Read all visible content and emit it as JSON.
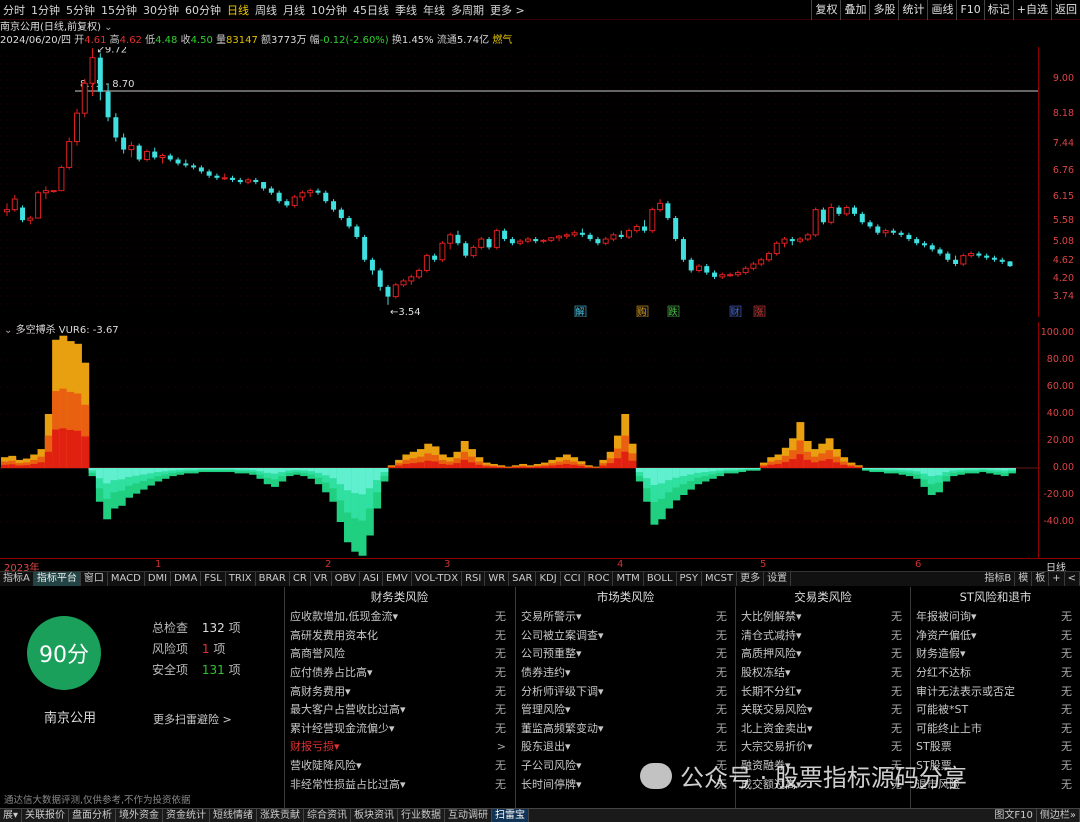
{
  "colors": {
    "up": "#e02020",
    "down": "#40e0e0",
    "accent": "#f0c800",
    "grid": "#8b0000",
    "score_green": "#1aa05a"
  },
  "topbar": {
    "periods": [
      "分时",
      "1分钟",
      "5分钟",
      "15分钟",
      "30分钟",
      "60分钟",
      "日线",
      "周线",
      "月线",
      "10分钟",
      "45日线",
      "季线",
      "年线",
      "多周期",
      "更多 >"
    ],
    "active_period": "日线",
    "right_tools": [
      "复权",
      "叠加",
      "多股",
      "统计",
      "画线",
      "F10",
      "标记",
      "+自选",
      "返回"
    ]
  },
  "info": {
    "name_line": "南京公用(日线,前复权)",
    "date": "2024/06/20/四",
    "open_label": "开",
    "open": "4.61",
    "high_label": "高",
    "high": "4.62",
    "low_label": "低",
    "low": "4.48",
    "close_label": "收",
    "close": "4.50",
    "vol_label": "量",
    "vol": "83147",
    "amt_label": "额",
    "amt": "3773万",
    "chg_label": "幅",
    "chg": "-0.12(-2.60%)",
    "turn_label": "换",
    "turn": "1.45%",
    "float_label": "流通",
    "float": "5.74亿",
    "sector": "燃气"
  },
  "kline": {
    "yaxis_labels": [
      "9.00",
      "8.18",
      "7.44",
      "6.76",
      "6.15",
      "5.58",
      "5.08",
      "4.62",
      "4.20",
      "3.74"
    ],
    "max_label": "9.72",
    "min_label": "3.54",
    "line_label": "8.75 - 8.70",
    "event_markers": [
      "解",
      "购",
      "跌",
      "财",
      "涨"
    ],
    "candles_ohlc": [
      [
        5.8,
        6.0,
        5.7,
        5.85
      ],
      [
        5.85,
        6.2,
        5.8,
        6.1
      ],
      [
        5.9,
        5.95,
        5.55,
        5.6
      ],
      [
        5.6,
        5.7,
        5.5,
        5.65
      ],
      [
        5.65,
        6.3,
        5.65,
        6.25
      ],
      [
        6.25,
        6.4,
        6.1,
        6.3
      ],
      [
        6.3,
        6.3,
        6.25,
        6.3
      ],
      [
        6.3,
        6.9,
        6.3,
        6.85
      ],
      [
        6.85,
        7.6,
        6.8,
        7.5
      ],
      [
        7.5,
        8.3,
        7.4,
        8.2
      ],
      [
        8.2,
        9.0,
        8.1,
        8.9
      ],
      [
        8.9,
        9.72,
        8.6,
        9.5
      ],
      [
        9.5,
        9.6,
        8.5,
        8.7
      ],
      [
        8.7,
        8.9,
        8.0,
        8.1
      ],
      [
        8.1,
        8.2,
        7.5,
        7.6
      ],
      [
        7.6,
        7.7,
        7.2,
        7.3
      ],
      [
        7.3,
        7.5,
        7.1,
        7.4
      ],
      [
        7.4,
        7.45,
        7.0,
        7.05
      ],
      [
        7.05,
        7.3,
        7.0,
        7.25
      ],
      [
        7.25,
        7.35,
        7.05,
        7.1
      ],
      [
        7.1,
        7.2,
        6.95,
        7.15
      ],
      [
        7.15,
        7.2,
        7.0,
        7.05
      ],
      [
        7.05,
        7.1,
        6.9,
        6.95
      ],
      [
        6.95,
        7.05,
        6.85,
        6.9
      ],
      [
        6.9,
        6.95,
        6.8,
        6.85
      ],
      [
        6.85,
        6.9,
        6.7,
        6.75
      ],
      [
        6.75,
        6.8,
        6.6,
        6.65
      ],
      [
        6.65,
        6.7,
        6.55,
        6.6
      ],
      [
        6.6,
        6.7,
        6.55,
        6.6
      ],
      [
        6.6,
        6.65,
        6.5,
        6.55
      ],
      [
        6.55,
        6.6,
        6.45,
        6.5
      ],
      [
        6.5,
        6.6,
        6.45,
        6.55
      ],
      [
        6.55,
        6.6,
        6.45,
        6.5
      ],
      [
        6.5,
        6.5,
        6.3,
        6.35
      ],
      [
        6.35,
        6.4,
        6.2,
        6.25
      ],
      [
        6.25,
        6.3,
        6.0,
        6.05
      ],
      [
        6.05,
        6.1,
        5.9,
        5.95
      ],
      [
        5.95,
        6.2,
        5.9,
        6.15
      ],
      [
        6.15,
        6.3,
        6.05,
        6.25
      ],
      [
        6.25,
        6.35,
        6.15,
        6.3
      ],
      [
        6.3,
        6.35,
        6.2,
        6.25
      ],
      [
        6.25,
        6.3,
        6.0,
        6.05
      ],
      [
        6.05,
        6.1,
        5.8,
        5.85
      ],
      [
        5.85,
        5.9,
        5.6,
        5.65
      ],
      [
        5.65,
        5.7,
        5.4,
        5.45
      ],
      [
        5.45,
        5.5,
        5.15,
        5.2
      ],
      [
        5.2,
        5.25,
        4.6,
        4.65
      ],
      [
        4.65,
        4.7,
        4.3,
        4.4
      ],
      [
        4.4,
        4.45,
        3.9,
        4.0
      ],
      [
        4.0,
        4.05,
        3.54,
        3.75
      ],
      [
        3.75,
        4.1,
        3.7,
        4.05
      ],
      [
        4.05,
        4.2,
        4.0,
        4.15
      ],
      [
        4.15,
        4.3,
        4.05,
        4.25
      ],
      [
        4.25,
        4.45,
        4.2,
        4.4
      ],
      [
        4.4,
        4.8,
        4.35,
        4.75
      ],
      [
        4.75,
        4.8,
        4.6,
        4.65
      ],
      [
        4.65,
        5.1,
        4.6,
        5.05
      ],
      [
        5.05,
        5.3,
        4.9,
        5.25
      ],
      [
        5.25,
        5.35,
        5.0,
        5.05
      ],
      [
        5.05,
        5.1,
        4.7,
        4.75
      ],
      [
        4.75,
        5.0,
        4.7,
        4.95
      ],
      [
        4.95,
        5.2,
        4.9,
        5.15
      ],
      [
        5.15,
        5.2,
        4.9,
        4.95
      ],
      [
        4.95,
        5.4,
        4.9,
        5.35
      ],
      [
        5.35,
        5.4,
        5.1,
        5.15
      ],
      [
        5.15,
        5.2,
        5.0,
        5.05
      ],
      [
        5.05,
        5.15,
        5.0,
        5.1
      ],
      [
        5.1,
        5.2,
        5.05,
        5.15
      ],
      [
        5.15,
        5.2,
        5.05,
        5.1
      ],
      [
        5.1,
        5.15,
        5.05,
        5.12
      ],
      [
        5.12,
        5.2,
        5.08,
        5.18
      ],
      [
        5.18,
        5.25,
        5.1,
        5.22
      ],
      [
        5.22,
        5.3,
        5.15,
        5.25
      ],
      [
        5.25,
        5.35,
        5.2,
        5.3
      ],
      [
        5.3,
        5.4,
        5.2,
        5.25
      ],
      [
        5.25,
        5.3,
        5.1,
        5.15
      ],
      [
        5.15,
        5.2,
        5.0,
        5.05
      ],
      [
        5.05,
        5.2,
        5.0,
        5.15
      ],
      [
        5.15,
        5.3,
        5.1,
        5.25
      ],
      [
        5.25,
        5.35,
        5.15,
        5.2
      ],
      [
        5.2,
        5.4,
        5.15,
        5.35
      ],
      [
        5.35,
        5.5,
        5.3,
        5.45
      ],
      [
        5.45,
        5.6,
        5.3,
        5.35
      ],
      [
        5.35,
        5.9,
        5.3,
        5.85
      ],
      [
        5.85,
        6.1,
        5.8,
        6.0
      ],
      [
        6.0,
        6.05,
        5.6,
        5.65
      ],
      [
        5.65,
        5.7,
        5.1,
        5.15
      ],
      [
        5.15,
        5.2,
        4.6,
        4.65
      ],
      [
        4.65,
        4.7,
        4.35,
        4.4
      ],
      [
        4.4,
        4.55,
        4.35,
        4.5
      ],
      [
        4.5,
        4.55,
        4.3,
        4.35
      ],
      [
        4.35,
        4.4,
        4.2,
        4.25
      ],
      [
        4.25,
        4.35,
        4.2,
        4.3
      ],
      [
        4.3,
        4.35,
        4.25,
        4.3
      ],
      [
        4.3,
        4.4,
        4.25,
        4.35
      ],
      [
        4.35,
        4.5,
        4.3,
        4.45
      ],
      [
        4.45,
        4.6,
        4.4,
        4.55
      ],
      [
        4.55,
        4.7,
        4.5,
        4.65
      ],
      [
        4.65,
        4.85,
        4.6,
        4.8
      ],
      [
        4.8,
        5.1,
        4.75,
        5.05
      ],
      [
        5.05,
        5.2,
        4.95,
        5.15
      ],
      [
        5.15,
        5.2,
        5.0,
        5.1
      ],
      [
        5.1,
        5.2,
        5.05,
        5.15
      ],
      [
        5.15,
        5.3,
        5.1,
        5.25
      ],
      [
        5.25,
        5.9,
        5.2,
        5.85
      ],
      [
        5.85,
        5.9,
        5.5,
        5.55
      ],
      [
        5.55,
        6.0,
        5.5,
        5.9
      ],
      [
        5.9,
        5.95,
        5.7,
        5.75
      ],
      [
        5.75,
        5.95,
        5.7,
        5.9
      ],
      [
        5.9,
        5.95,
        5.7,
        5.75
      ],
      [
        5.75,
        5.8,
        5.5,
        5.55
      ],
      [
        5.55,
        5.6,
        5.4,
        5.45
      ],
      [
        5.45,
        5.5,
        5.25,
        5.3
      ],
      [
        5.3,
        5.4,
        5.2,
        5.35
      ],
      [
        5.35,
        5.4,
        5.25,
        5.3
      ],
      [
        5.3,
        5.35,
        5.2,
        5.25
      ],
      [
        5.25,
        5.3,
        5.1,
        5.15
      ],
      [
        5.15,
        5.2,
        5.0,
        5.05
      ],
      [
        5.05,
        5.1,
        4.95,
        5.0
      ],
      [
        5.0,
        5.05,
        4.85,
        4.9
      ],
      [
        4.9,
        4.95,
        4.75,
        4.8
      ],
      [
        4.8,
        4.85,
        4.6,
        4.65
      ],
      [
        4.65,
        4.75,
        4.5,
        4.55
      ],
      [
        4.55,
        4.8,
        4.5,
        4.75
      ],
      [
        4.75,
        4.85,
        4.7,
        4.8
      ],
      [
        4.8,
        4.85,
        4.7,
        4.75
      ],
      [
        4.75,
        4.8,
        4.65,
        4.7
      ],
      [
        4.7,
        4.75,
        4.6,
        4.65
      ],
      [
        4.65,
        4.7,
        4.55,
        4.6
      ],
      [
        4.61,
        4.62,
        4.48,
        4.5
      ]
    ]
  },
  "vur": {
    "title": "多空搏杀",
    "label": "VUR6:",
    "value": "-3.67",
    "yaxis_labels": [
      "100.00",
      "80.00",
      "60.00",
      "40.00",
      "20.00",
      "0.00",
      "-20.00",
      "-40.00"
    ],
    "values": [
      8,
      9,
      6,
      7,
      10,
      14,
      40,
      95,
      98,
      94,
      92,
      78,
      -6,
      -25,
      -38,
      -30,
      -28,
      -22,
      -19,
      -16,
      -13,
      -10,
      -8,
      -6,
      -5,
      -4,
      -4,
      -3,
      -3,
      -3,
      -3,
      -3,
      -4,
      -4,
      -5,
      -8,
      -12,
      -14,
      -10,
      -6,
      -5,
      -6,
      -8,
      -12,
      -18,
      -25,
      -40,
      -55,
      -62,
      -65,
      -50,
      -30,
      -10,
      2,
      6,
      10,
      12,
      14,
      18,
      16,
      10,
      8,
      12,
      20,
      14,
      8,
      4,
      3,
      2,
      1,
      2,
      3,
      2,
      3,
      4,
      6,
      8,
      10,
      8,
      5,
      2,
      1,
      6,
      12,
      24,
      40,
      18,
      -10,
      -25,
      -42,
      -38,
      -30,
      -24,
      -20,
      -16,
      -12,
      -10,
      -8,
      -6,
      -4,
      -4,
      -3,
      -2,
      -2,
      4,
      8,
      10,
      15,
      22,
      34,
      20,
      14,
      18,
      22,
      14,
      8,
      4,
      2,
      -2,
      -3,
      -3,
      -4,
      -4,
      -5,
      -6,
      -8,
      -14,
      -20,
      -18,
      -10,
      -6,
      -5,
      -4,
      -4,
      -3,
      -4,
      -5,
      -6,
      -4
    ]
  },
  "time_axis": {
    "labels": [
      "2023年",
      "1",
      "2",
      "3",
      "4",
      "5",
      "6"
    ],
    "right_label": "日线"
  },
  "indicator_tabs": [
    "指标A",
    "指标平台",
    "窗口",
    "MACD",
    "DMI",
    "DMA",
    "FSL",
    "TRIX",
    "BRAR",
    "CR",
    "VR",
    "OBV",
    "ASI",
    "EMV",
    "VOL-TDX",
    "RSI",
    "WR",
    "SAR",
    "KDJ",
    "CCI",
    "ROC",
    "MTM",
    "BOLL",
    "PSY",
    "MCST",
    "更多",
    "设置"
  ],
  "indicator_tabs_right": [
    "指标B",
    "模",
    "板",
    "+",
    "<"
  ],
  "scan": {
    "score": "90分",
    "total_label": "总检查",
    "total": "132",
    "total_unit": "项",
    "risk_label": "风险项",
    "risk": "1",
    "risk_unit": "项",
    "safe_label": "安全项",
    "safe": "131",
    "safe_unit": "项",
    "company": "南京公用",
    "more": "更多扫雷避险 >",
    "footnote": "通达信大数据评测,仅供参考,不作为投资依据",
    "columns": [
      {
        "title": "财务类风险",
        "items": [
          {
            "label": "应收款增加,低现金流▾",
            "value": "无",
            "risk": false
          },
          {
            "label": "高研发费用资本化",
            "value": "无",
            "risk": false
          },
          {
            "label": "高商誉风险",
            "value": "无",
            "risk": false
          },
          {
            "label": "应付债券占比高▾",
            "value": "无",
            "risk": false
          },
          {
            "label": "高财务费用▾",
            "value": "无",
            "risk": false
          },
          {
            "label": "最大客户占营收比过高▾",
            "value": "无",
            "risk": false
          },
          {
            "label": "累计经营现金流偏少▾",
            "value": "无",
            "risk": false
          },
          {
            "label": "财报亏损▾",
            "value": ">",
            "risk": true
          },
          {
            "label": "营收陡降风险▾",
            "value": "无",
            "risk": false
          },
          {
            "label": "非经常性损益占比过高▾",
            "value": "无",
            "risk": false
          }
        ]
      },
      {
        "title": "市场类风险",
        "items": [
          {
            "label": "交易所警示▾",
            "value": "无",
            "risk": false
          },
          {
            "label": "公司被立案调查▾",
            "value": "无",
            "risk": false
          },
          {
            "label": "公司预重整▾",
            "value": "无",
            "risk": false
          },
          {
            "label": "债券违约▾",
            "value": "无",
            "risk": false
          },
          {
            "label": "分析师评级下调▾",
            "value": "无",
            "risk": false
          },
          {
            "label": "管理风险▾",
            "value": "无",
            "risk": false
          },
          {
            "label": "董监高频繁变动▾",
            "value": "无",
            "risk": false
          },
          {
            "label": "股东退出▾",
            "value": "无",
            "risk": false
          },
          {
            "label": "子公司风险▾",
            "value": "无",
            "risk": false
          },
          {
            "label": "长时间停牌▾",
            "value": "无",
            "risk": false
          }
        ]
      },
      {
        "title": "交易类风险",
        "items": [
          {
            "label": "大比例解禁▾",
            "value": "无",
            "risk": false
          },
          {
            "label": "清仓式减持▾",
            "value": "无",
            "risk": false
          },
          {
            "label": "高质押风险▾",
            "value": "无",
            "risk": false
          },
          {
            "label": "股权冻结▾",
            "value": "无",
            "risk": false
          },
          {
            "label": "长期不分红▾",
            "value": "无",
            "risk": false
          },
          {
            "label": "关联交易风险▾",
            "value": "无",
            "risk": false
          },
          {
            "label": "北上资金卖出▾",
            "value": "无",
            "risk": false
          },
          {
            "label": "大宗交易折价▾",
            "value": "无",
            "risk": false
          },
          {
            "label": "融资融券▾",
            "value": "无",
            "risk": false
          },
          {
            "label": "成交额过高▾",
            "value": "无",
            "risk": false
          }
        ]
      },
      {
        "title": "ST风险和退市",
        "items": [
          {
            "label": "年报被问询▾",
            "value": "无",
            "risk": false
          },
          {
            "label": "净资产偏低▾",
            "value": "无",
            "risk": false
          },
          {
            "label": "财务造假▾",
            "value": "无",
            "risk": false
          },
          {
            "label": "分红不达标",
            "value": "无",
            "risk": false
          },
          {
            "label": "审计无法表示或否定",
            "value": "无",
            "risk": false
          },
          {
            "label": "可能被*ST",
            "value": "无",
            "risk": false
          },
          {
            "label": "可能终止上市",
            "value": "无",
            "risk": false
          },
          {
            "label": "ST股票",
            "value": "无",
            "risk": false
          },
          {
            "label": "ST股票",
            "value": "无",
            "risk": false
          },
          {
            "label": "退市风险",
            "value": "无",
            "risk": false
          }
        ]
      }
    ]
  },
  "watermark": "公众号 · 股票指标源码分享",
  "bottom_tabs": [
    "展▾",
    "关联报价",
    "盘面分析",
    "境外资金",
    "资金统计",
    "短线情绪",
    "涨跌贡献",
    "综合资讯",
    "板块资讯",
    "行业数据",
    "互动调研",
    "扫雷宝"
  ],
  "bottom_active": "扫雷宝",
  "bottom_right": [
    "图文F10",
    "侧边栏»"
  ]
}
